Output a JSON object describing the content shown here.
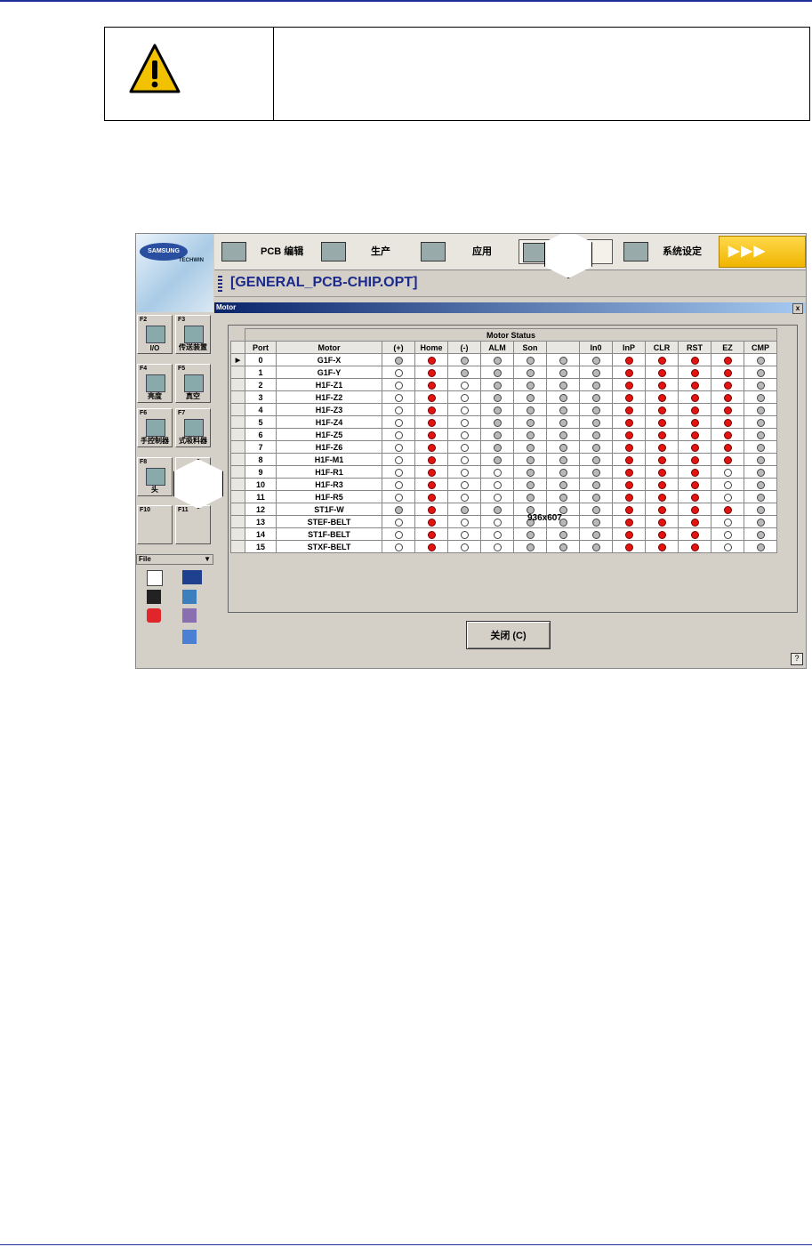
{
  "app": {
    "logo": {
      "brand": "SAMSUNG",
      "sub": "TECHWIN"
    },
    "toolbar": [
      {
        "label": "PCB 编辑",
        "icon": "pcb-edit-icon"
      },
      {
        "label": "生产",
        "icon": "production-icon"
      },
      {
        "label": "应用",
        "icon": "application-icon"
      },
      {
        "label": "",
        "icon": "manual-icon"
      },
      {
        "label": "系统设定",
        "icon": "system-settings-icon"
      }
    ],
    "go_label": "▶▶▶",
    "project_title": "[GENERAL_PCB-CHIP.OPT]",
    "fkeys": [
      {
        "key": "F2",
        "label": "I/O"
      },
      {
        "key": "F3",
        "label": "传送装置"
      },
      {
        "key": "F4",
        "label": "亮度"
      },
      {
        "key": "F5",
        "label": "真空"
      },
      {
        "key": "F6",
        "label": "手控制器"
      },
      {
        "key": "F7",
        "label": "式吸料器"
      },
      {
        "key": "F8",
        "label": "头"
      },
      {
        "key": "",
        "label": ""
      },
      {
        "key": "F10",
        "label": ""
      },
      {
        "key": "F11",
        "label": ""
      }
    ],
    "file_label": "File",
    "dialog": {
      "title": "Motor",
      "close_x": "x",
      "table_title": "Motor Status",
      "columns": [
        "Port",
        "Motor",
        "(+)",
        "Home",
        "(-)",
        "ALM",
        "Son",
        "",
        "In0",
        "InP",
        "CLR",
        "RST",
        "EZ",
        "CMP"
      ],
      "rows": [
        {
          "port": "0",
          "motor": "G1F-X",
          "s": [
            "g",
            "r",
            "g",
            "g",
            "g",
            "g",
            "g",
            "r",
            "r",
            "r",
            "r",
            "g"
          ]
        },
        {
          "port": "1",
          "motor": "G1F-Y",
          "s": [
            "w",
            "r",
            "g",
            "g",
            "g",
            "g",
            "g",
            "r",
            "r",
            "r",
            "r",
            "g"
          ]
        },
        {
          "port": "2",
          "motor": "H1F-Z1",
          "s": [
            "w",
            "r",
            "w",
            "g",
            "g",
            "g",
            "g",
            "r",
            "r",
            "r",
            "r",
            "g"
          ]
        },
        {
          "port": "3",
          "motor": "H1F-Z2",
          "s": [
            "w",
            "r",
            "w",
            "g",
            "g",
            "g",
            "g",
            "r",
            "r",
            "r",
            "r",
            "g"
          ]
        },
        {
          "port": "4",
          "motor": "H1F-Z3",
          "s": [
            "w",
            "r",
            "w",
            "g",
            "g",
            "g",
            "g",
            "r",
            "r",
            "r",
            "r",
            "g"
          ]
        },
        {
          "port": "5",
          "motor": "H1F-Z4",
          "s": [
            "w",
            "r",
            "w",
            "g",
            "g",
            "g",
            "g",
            "r",
            "r",
            "r",
            "r",
            "g"
          ]
        },
        {
          "port": "6",
          "motor": "H1F-Z5",
          "s": [
            "w",
            "r",
            "w",
            "g",
            "g",
            "g",
            "g",
            "r",
            "r",
            "r",
            "r",
            "g"
          ]
        },
        {
          "port": "7",
          "motor": "H1F-Z6",
          "s": [
            "w",
            "r",
            "w",
            "g",
            "g",
            "g",
            "g",
            "r",
            "r",
            "r",
            "r",
            "g"
          ]
        },
        {
          "port": "8",
          "motor": "H1F-M1",
          "s": [
            "w",
            "r",
            "w",
            "g",
            "g",
            "g",
            "g",
            "r",
            "r",
            "r",
            "r",
            "g"
          ]
        },
        {
          "port": "9",
          "motor": "H1F-R1",
          "s": [
            "w",
            "r",
            "w",
            "w",
            "g",
            "g",
            "g",
            "r",
            "r",
            "r",
            "w",
            "g"
          ]
        },
        {
          "port": "10",
          "motor": "H1F-R3",
          "s": [
            "w",
            "r",
            "w",
            "w",
            "g",
            "g",
            "g",
            "r",
            "r",
            "r",
            "w",
            "g"
          ]
        },
        {
          "port": "11",
          "motor": "H1F-R5",
          "s": [
            "w",
            "r",
            "w",
            "w",
            "g",
            "g",
            "g",
            "r",
            "r",
            "r",
            "w",
            "g"
          ]
        },
        {
          "port": "12",
          "motor": "ST1F-W",
          "s": [
            "g",
            "r",
            "g",
            "g",
            "g",
            "g",
            "g",
            "r",
            "r",
            "r",
            "r",
            "g"
          ]
        },
        {
          "port": "13",
          "motor": "STEF-BELT",
          "s": [
            "w",
            "r",
            "w",
            "w",
            "g",
            "g",
            "g",
            "r",
            "r",
            "r",
            "w",
            "g"
          ]
        },
        {
          "port": "14",
          "motor": "ST1F-BELT",
          "s": [
            "w",
            "r",
            "w",
            "w",
            "g",
            "g",
            "g",
            "r",
            "r",
            "r",
            "w",
            "g"
          ]
        },
        {
          "port": "15",
          "motor": "STXF-BELT",
          "s": [
            "w",
            "r",
            "w",
            "w",
            "g",
            "g",
            "g",
            "r",
            "r",
            "r",
            "w",
            "g"
          ]
        }
      ],
      "close_button": "关闭 (C)",
      "help": "?",
      "overlay_text": "936x607"
    }
  },
  "colors": {
    "rule": "#1f2f9a",
    "led_red": "#e3130f",
    "led_gray": "#b9b9b9",
    "go": "#f0b400"
  }
}
